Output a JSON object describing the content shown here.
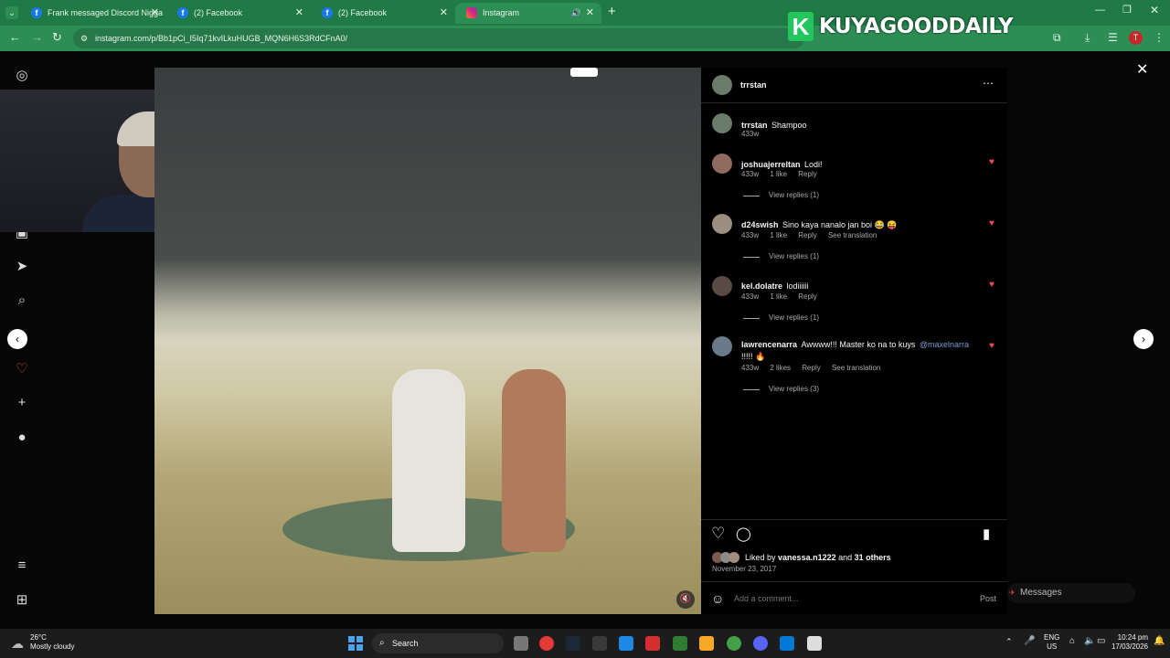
{
  "browser": {
    "tabs": [
      {
        "title": "Frank messaged Discord Nigga"
      },
      {
        "title": "(2) Facebook"
      },
      {
        "title": "(2) Facebook"
      },
      {
        "title": "Instagram"
      }
    ],
    "url": "instagram.com/p/Bb1pCi_I5Iq71kvILkuHUGB_MQN6H6S3RdCFnA0/"
  },
  "brand": {
    "letter": "K",
    "text": "KUYAGOODDAILY"
  },
  "post": {
    "author": "trrstan",
    "caption_user": "trrstan",
    "caption_text": "Shampoo",
    "caption_time": "433w",
    "comments": [
      {
        "user": "joshuajerreltan",
        "text": "Lodi!",
        "time": "433w",
        "likes": "1 like",
        "reply": "Reply",
        "translation": "",
        "view_replies": "View replies (1)"
      },
      {
        "user": "d24swish",
        "text": "Sino kaya nanalo jan boi 😂 😝",
        "time": "433w",
        "likes": "1 like",
        "reply": "Reply",
        "translation": "See translation",
        "view_replies": "View replies (1)"
      },
      {
        "user": "kel.dolatre",
        "text": "lodiiiiii",
        "time": "433w",
        "likes": "1 like",
        "reply": "Reply",
        "translation": "",
        "view_replies": "View replies (1)"
      },
      {
        "user": "lawrencenarra",
        "text": "Awwww!!! Master ko na to kuys",
        "mention": "@maxelnarra",
        "text2": "!!!!! 🔥",
        "time": "433w",
        "likes": "2 likes",
        "reply": "Reply",
        "translation": "See translation",
        "view_replies": "View replies (3)"
      }
    ],
    "liked_prefix": "Liked by",
    "liked_user": "vanessa.n1222",
    "liked_and": "and",
    "liked_others": "31 others",
    "date": "November 23, 2017",
    "comment_placeholder": "Add a comment...",
    "post_button": "Post"
  },
  "messages_label": "Messages",
  "taskbar": {
    "weather_temp": "26°C",
    "weather_desc": "Mostly cloudy",
    "search": "Search",
    "lang1": "ENG",
    "lang2": "US",
    "time": "10:24 pm",
    "date": "17/03/2026"
  }
}
